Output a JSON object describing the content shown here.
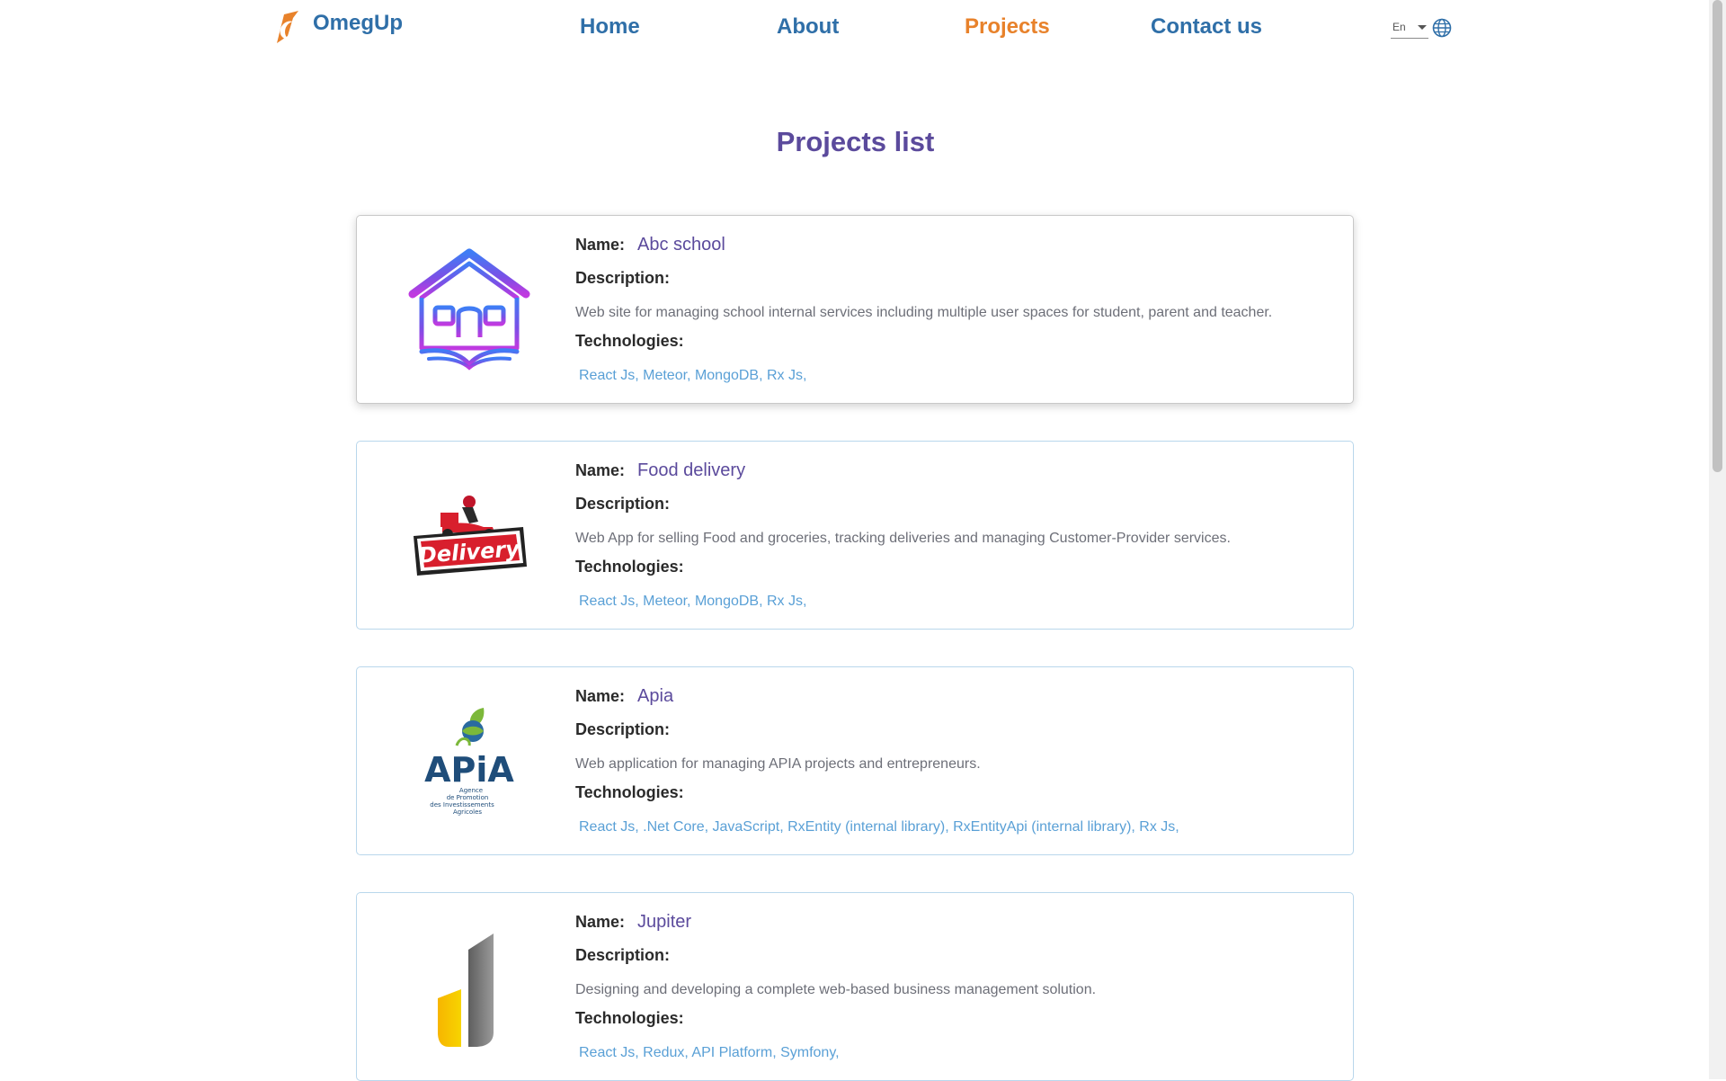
{
  "brand": {
    "name": "OmegUp",
    "logo_icon": "omegup-flame-logo-icon",
    "color": "#2f6fa8"
  },
  "nav": {
    "items": [
      {
        "label": "Home",
        "active": false
      },
      {
        "label": "About",
        "active": false
      },
      {
        "label": "Projects",
        "active": true
      },
      {
        "label": "Contact us",
        "active": false
      }
    ],
    "active_color": "#e8822b"
  },
  "language": {
    "selected": "En",
    "icon": "globe-icon"
  },
  "page": {
    "title": "Projects list"
  },
  "labels": {
    "name": "Name:",
    "description": "Description:",
    "technologies": "Technologies:"
  },
  "projects": [
    {
      "name": "Abc school",
      "logo": "school-house-book-logo",
      "description": "Web site for managing school internal services including multiple user spaces for student, parent and teacher.",
      "technologies": "React Js, Meteor, MongoDB, Rx Js,"
    },
    {
      "name": "Food delivery",
      "logo": "delivery-scooter-logo",
      "description": "Web App for selling Food and groceries, tracking deliveries and managing Customer-Provider services.",
      "technologies": "React Js, Meteor, MongoDB, Rx Js,",
      "logo_text": "Delivery"
    },
    {
      "name": "Apia",
      "logo": "apia-agency-logo",
      "description": "Web application for managing APIA projects and entrepreneurs.",
      "technologies": "React Js, .Net Core, JavaScript, RxEntity (internal library), RxEntityApi (internal library), Rx Js,",
      "logo_text": "APiA",
      "logo_subtext": [
        "Agence",
        "de Promotion",
        "des Investissements",
        "Agricoles"
      ]
    },
    {
      "name": "Jupiter",
      "logo": "jupiter-j-logo",
      "description": "Designing and developing a complete web-based business management solution.",
      "technologies": "React Js, Redux, API Platform, Symfony,"
    }
  ],
  "colors": {
    "title": "#5b4a9c",
    "technologies": "#5aa0d6",
    "card_border": "#b9d7ec"
  }
}
